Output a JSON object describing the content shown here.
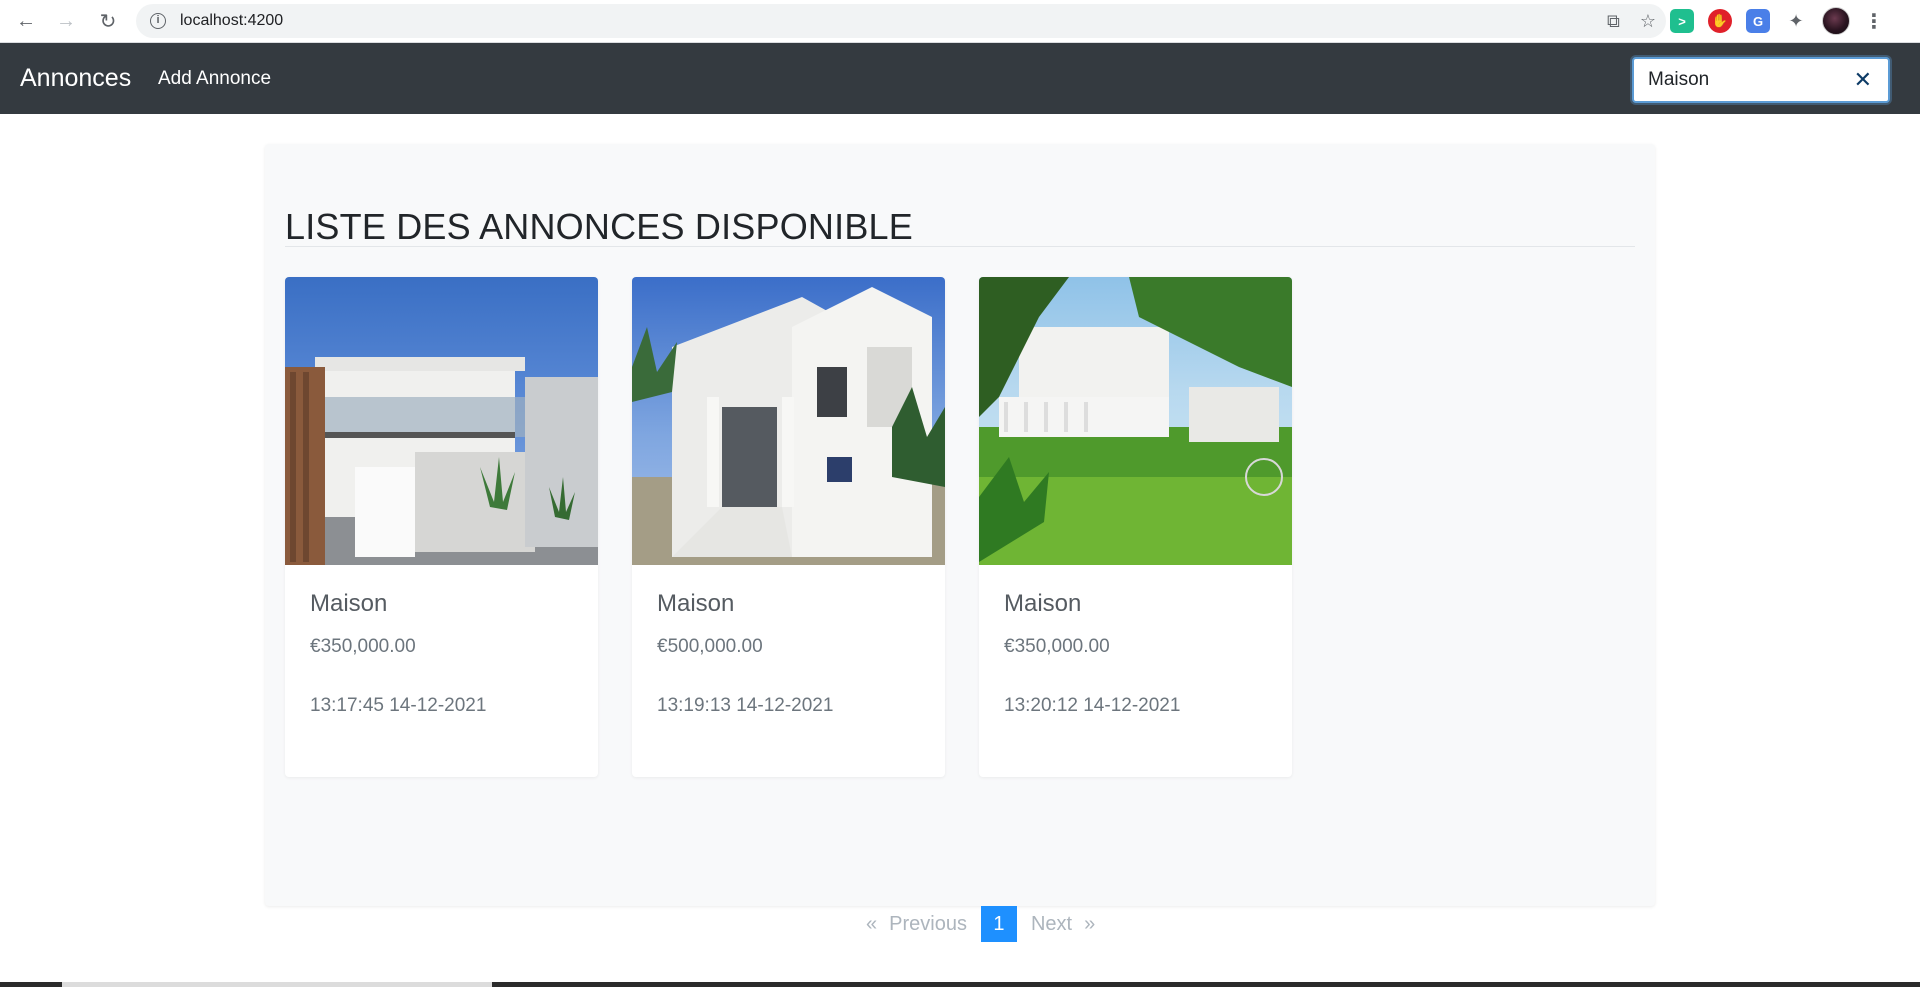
{
  "browser": {
    "url": "localhost:4200",
    "back_icon": "arrow-left-icon",
    "forward_icon": "arrow-right-icon",
    "reload_icon": "reload-icon"
  },
  "navbar": {
    "brand": "Annonces",
    "add_link": "Add Annonce",
    "search": {
      "value": "Maison"
    }
  },
  "main": {
    "title": "LISTE DES ANNONCES DISPONIBLE",
    "cards": [
      {
        "title": "Maison",
        "price": "€350,000.00",
        "date": "13:17:45 14-12-2021",
        "image": "modern-house-photo"
      },
      {
        "title": "Maison",
        "price": "€500,000.00",
        "date": "13:19:13 14-12-2021",
        "image": "white-house-photo"
      },
      {
        "title": "Maison",
        "price": "€350,000.00",
        "date": "13:20:12 14-12-2021",
        "image": "garden-house-photo"
      }
    ]
  },
  "pagination": {
    "prev_arrow": "«",
    "previous": "Previous",
    "current": "1",
    "next": "Next",
    "next_arrow": "»"
  },
  "colors": {
    "navbar_bg": "#343a40",
    "page_active": "#1e90ff",
    "panel_bg": "#f8f9fa"
  }
}
